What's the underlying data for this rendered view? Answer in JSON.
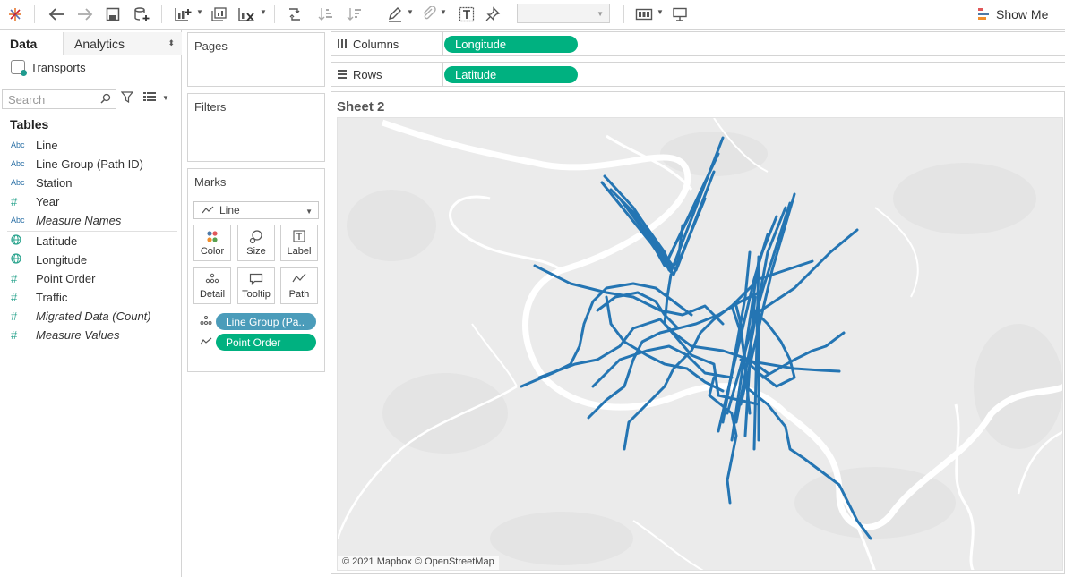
{
  "toolbar": {
    "icons": [
      "tableau-logo-icon",
      "undo-icon",
      "redo-icon",
      "save-icon",
      "new-datasource-icon",
      "new-worksheet-icon",
      "duplicate-sheet-icon",
      "clear-sheet-icon",
      "swap-icon",
      "sort-ascending-icon",
      "sort-descending-icon",
      "highlight-icon",
      "group-icon",
      "show-labels-icon",
      "pin-icon",
      "fit-icon",
      "presentation-icon"
    ],
    "fit_dropdown_value": "",
    "show_me_label": "Show Me"
  },
  "left_pane": {
    "tabs": {
      "data": "Data",
      "analytics": "Analytics"
    },
    "datasource": "Transports",
    "search_placeholder": "Search",
    "tables_title": "Tables",
    "fields": [
      {
        "type": "Abc",
        "label": "Line"
      },
      {
        "type": "Abc",
        "label": "Line Group (Path ID)"
      },
      {
        "type": "Abc",
        "label": "Station"
      },
      {
        "type": "#",
        "label": "Year"
      },
      {
        "type": "Abc",
        "label": "Measure Names"
      },
      {
        "type": "globe",
        "label": "Latitude"
      },
      {
        "type": "globe",
        "label": "Longitude"
      },
      {
        "type": "#",
        "label": "Point Order"
      },
      {
        "type": "#",
        "label": "Traffic"
      },
      {
        "type": "#",
        "label": "Migrated Data (Count)"
      },
      {
        "type": "#",
        "label": "Measure Values"
      }
    ]
  },
  "pages": {
    "title": "Pages"
  },
  "filters": {
    "title": "Filters"
  },
  "marks": {
    "title": "Marks",
    "type": "Line",
    "buttons": [
      "Color",
      "Size",
      "Label",
      "Detail",
      "Tooltip",
      "Path"
    ],
    "pills": [
      "Line Group (Pa..",
      "Point Order"
    ]
  },
  "shelves": {
    "columns_label": "Columns",
    "columns_pill": "Longitude",
    "rows_label": "Rows",
    "rows_pill": "Latitude"
  },
  "sheet": {
    "title": "Sheet 2",
    "attribution": "© 2021 Mapbox © OpenStreetMap",
    "line_color": "#2475b3",
    "map_background": "#ebebeb"
  }
}
